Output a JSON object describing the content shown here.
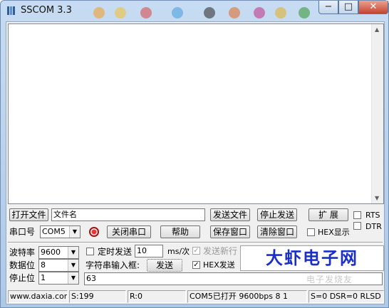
{
  "window": {
    "title": "SSCOM 3.3",
    "minimize": "−",
    "maximize": "□",
    "close": "✕"
  },
  "row1": {
    "open_file": "打开文件",
    "file_name": "文件名",
    "send_file": "发送文件",
    "stop_send": "停止发送",
    "expand": "扩 展",
    "rts": "RTS",
    "dtr": "DTR"
  },
  "row2": {
    "port_label": "串口号",
    "port_value": "COM5",
    "close_port": "关闭串口",
    "help": "帮助",
    "save_window": "保存窗口",
    "clear_window": "清除窗口",
    "hex_display": "HEX显示"
  },
  "settings": {
    "baud_label": "波特率",
    "baud_value": "9600",
    "data_bits_label": "数据位",
    "data_bits_value": "8",
    "stop_bits_label": "停止位",
    "stop_bits_value": "1",
    "timed_send": "定时发送",
    "interval_value": "10",
    "interval_unit": "ms/次",
    "send_newline": "发送新行",
    "string_input_label": "字符串输入框:",
    "send_button": "发送",
    "hex_send": "HEX发送",
    "input_value": "63",
    "brand": "大虾电子网"
  },
  "status": {
    "website": "www.daxia.com",
    "sent": "S:199",
    "received": "R:0",
    "port_status": "COM5已打开  9600bps  8 1",
    "signals": "S=0 DSR=0 RLSD"
  },
  "watermark": "电子发烧友",
  "colors": {
    "brand_blue": "#1a2ec8",
    "close_red": "#c4432e",
    "titlebar_blue": "#aec8e6"
  }
}
